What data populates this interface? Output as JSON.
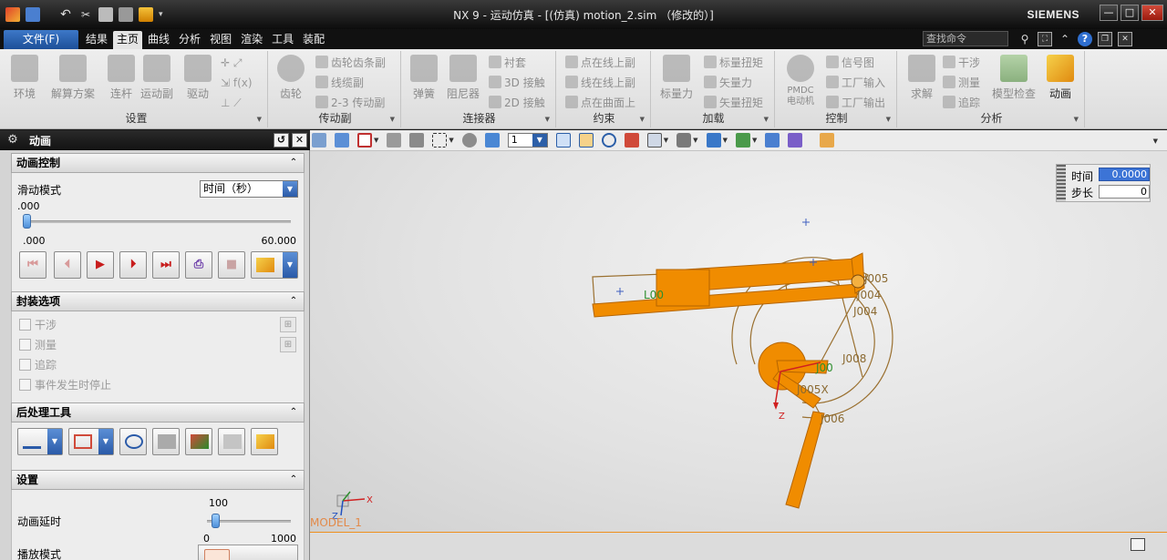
{
  "window": {
    "title": "NX 9 - 运动仿真 - [(仿真) motion_2.sim （修改的）]",
    "brand": "SIEMENS",
    "controls": [
      "—",
      "□",
      "✕"
    ]
  },
  "menubar": {
    "file_label": "文件(F)",
    "tabs": [
      "结果",
      "主页",
      "曲线",
      "分析",
      "视图",
      "渲染",
      "工具",
      "装配"
    ],
    "active_tab": "主页",
    "search_placeholder": "查找命令"
  },
  "ribbon": {
    "groups": {
      "setup": {
        "label": "设置",
        "buttons": [
          "环境",
          "解算方案",
          "连杆",
          "运动副",
          "驱动"
        ]
      },
      "coupler": {
        "label": "传动副",
        "big": "齿轮",
        "small": [
          "齿轮齿条副",
          "线缆副",
          "2-3 传动副"
        ]
      },
      "connector": {
        "label": "连接器",
        "big": [
          "弹簧",
          "阻尼器"
        ],
        "small": [
          "衬套",
          "3D 接触",
          "2D 接触"
        ]
      },
      "constraint": {
        "label": "约束",
        "small": [
          "点在线上副",
          "线在线上副",
          "点在曲面上"
        ]
      },
      "load": {
        "label": "加载",
        "big": "标量力",
        "small": [
          "标量扭矩",
          "矢量力",
          "矢量扭矩"
        ]
      },
      "control": {
        "label": "控制",
        "big": "PMDC 电动机",
        "small": [
          "信号图",
          "工厂输入",
          "工厂输出"
        ]
      },
      "analysis": {
        "label": "分析",
        "big": [
          "求解",
          "模型检查",
          "动画"
        ],
        "small": [
          "干涉",
          "测量",
          "追踪"
        ]
      }
    }
  },
  "toolbar2": {
    "layer_value": "1"
  },
  "dialog": {
    "title": "动画",
    "sections": {
      "animation_control": {
        "header": "动画控制",
        "slide_mode_label": "滑动模式",
        "slide_mode_value": "时间（秒）",
        "current_value": ".000",
        "min_label": ".000",
        "max_label": "60.000",
        "slider_fraction": 0.0
      },
      "packaging": {
        "header": "封装选项",
        "options": [
          "干涉",
          "测量",
          "追踪",
          "事件发生时停止"
        ]
      },
      "postprocess": {
        "header": "后处理工具"
      },
      "settings": {
        "header": "设置",
        "delay_label": "动画延时",
        "delay_value": "100",
        "delay_min": "0",
        "delay_max": "1000",
        "delay_fraction": 0.1,
        "playback_label": "播放模式"
      }
    }
  },
  "viewport": {
    "time_label": "时间",
    "time_value": "0.0000",
    "step_label": "步长",
    "step_value": "0",
    "model_label": "MODEL_1",
    "triad_labels": {
      "x": "X",
      "y": "Y",
      "z": "Z"
    },
    "joint_labels": [
      "J005",
      "J004",
      "J004",
      "J008",
      "L00",
      "J00",
      "J005X",
      "J006"
    ],
    "colors": {
      "mechanism": "#f08c00",
      "outline": "#9a7030",
      "label_brown": "#8b6a32",
      "label_green": "#2f8f2f"
    }
  }
}
